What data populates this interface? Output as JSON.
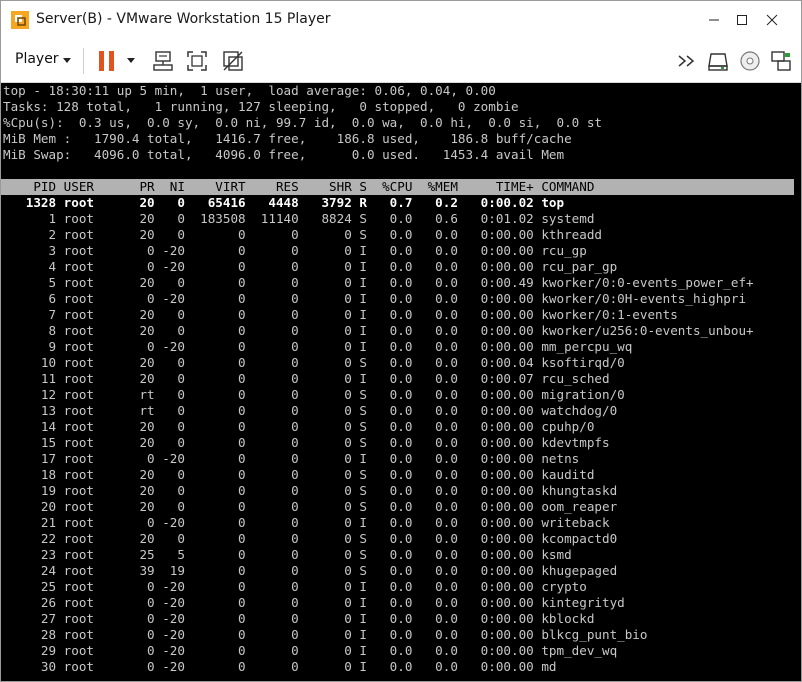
{
  "window": {
    "title": "Server(B) - VMware Workstation 15 Player"
  },
  "toolbar": {
    "player_label": "Player",
    "icons": [
      "pause-icon",
      "send-ctrl-alt-del-icon",
      "fullscreen-icon",
      "unity-icon",
      "forward-icon",
      "removable-device-icon",
      "cd-icon",
      "network-icon"
    ]
  },
  "colors": {
    "pause": "#e0541e",
    "header_bg": "#b2b2b2",
    "terminal_bg": "#000000",
    "terminal_fg": "#c8c8c8"
  },
  "top": {
    "summary": [
      "top - 18:30:11 up 5 min,  1 user,  load average: 0.06, 0.04, 0.00",
      "Tasks: 128 total,   1 running, 127 sleeping,   0 stopped,   0 zombie",
      "%Cpu(s):  0.3 us,  0.0 sy,  0.0 ni, 99.7 id,  0.0 wa,  0.0 hi,  0.0 si,  0.0 st",
      "MiB Mem :   1790.4 total,   1416.7 free,    186.8 used,    186.8 buff/cache",
      "MiB Swap:   4096.0 total,   4096.0 free,      0.0 used.   1453.4 avail Mem"
    ],
    "columns": [
      "PID",
      "USER",
      "PR",
      "NI",
      "VIRT",
      "RES",
      "SHR",
      "S",
      "%CPU",
      "%MEM",
      "TIME+",
      "COMMAND"
    ],
    "processes": [
      [
        "1328",
        "root",
        "20",
        "0",
        "65416",
        "4448",
        "3792",
        "R",
        "0.7",
        "0.2",
        "0:00.02",
        "top"
      ],
      [
        "1",
        "root",
        "20",
        "0",
        "183508",
        "11140",
        "8824",
        "S",
        "0.0",
        "0.6",
        "0:01.02",
        "systemd"
      ],
      [
        "2",
        "root",
        "20",
        "0",
        "0",
        "0",
        "0",
        "S",
        "0.0",
        "0.0",
        "0:00.00",
        "kthreadd"
      ],
      [
        "3",
        "root",
        "0",
        "-20",
        "0",
        "0",
        "0",
        "I",
        "0.0",
        "0.0",
        "0:00.00",
        "rcu_gp"
      ],
      [
        "4",
        "root",
        "0",
        "-20",
        "0",
        "0",
        "0",
        "I",
        "0.0",
        "0.0",
        "0:00.00",
        "rcu_par_gp"
      ],
      [
        "5",
        "root",
        "20",
        "0",
        "0",
        "0",
        "0",
        "I",
        "0.0",
        "0.0",
        "0:00.49",
        "kworker/0:0-events_power_ef+"
      ],
      [
        "6",
        "root",
        "0",
        "-20",
        "0",
        "0",
        "0",
        "I",
        "0.0",
        "0.0",
        "0:00.00",
        "kworker/0:0H-events_highpri"
      ],
      [
        "7",
        "root",
        "20",
        "0",
        "0",
        "0",
        "0",
        "I",
        "0.0",
        "0.0",
        "0:00.00",
        "kworker/0:1-events"
      ],
      [
        "8",
        "root",
        "20",
        "0",
        "0",
        "0",
        "0",
        "I",
        "0.0",
        "0.0",
        "0:00.00",
        "kworker/u256:0-events_unbou+"
      ],
      [
        "9",
        "root",
        "0",
        "-20",
        "0",
        "0",
        "0",
        "I",
        "0.0",
        "0.0",
        "0:00.00",
        "mm_percpu_wq"
      ],
      [
        "10",
        "root",
        "20",
        "0",
        "0",
        "0",
        "0",
        "S",
        "0.0",
        "0.0",
        "0:00.04",
        "ksoftirqd/0"
      ],
      [
        "11",
        "root",
        "20",
        "0",
        "0",
        "0",
        "0",
        "I",
        "0.0",
        "0.0",
        "0:00.07",
        "rcu_sched"
      ],
      [
        "12",
        "root",
        "rt",
        "0",
        "0",
        "0",
        "0",
        "S",
        "0.0",
        "0.0",
        "0:00.00",
        "migration/0"
      ],
      [
        "13",
        "root",
        "rt",
        "0",
        "0",
        "0",
        "0",
        "S",
        "0.0",
        "0.0",
        "0:00.00",
        "watchdog/0"
      ],
      [
        "14",
        "root",
        "20",
        "0",
        "0",
        "0",
        "0",
        "S",
        "0.0",
        "0.0",
        "0:00.00",
        "cpuhp/0"
      ],
      [
        "15",
        "root",
        "20",
        "0",
        "0",
        "0",
        "0",
        "S",
        "0.0",
        "0.0",
        "0:00.00",
        "kdevtmpfs"
      ],
      [
        "17",
        "root",
        "0",
        "-20",
        "0",
        "0",
        "0",
        "I",
        "0.0",
        "0.0",
        "0:00.00",
        "netns"
      ],
      [
        "18",
        "root",
        "20",
        "0",
        "0",
        "0",
        "0",
        "S",
        "0.0",
        "0.0",
        "0:00.00",
        "kauditd"
      ],
      [
        "19",
        "root",
        "20",
        "0",
        "0",
        "0",
        "0",
        "S",
        "0.0",
        "0.0",
        "0:00.00",
        "khungtaskd"
      ],
      [
        "20",
        "root",
        "20",
        "0",
        "0",
        "0",
        "0",
        "S",
        "0.0",
        "0.0",
        "0:00.00",
        "oom_reaper"
      ],
      [
        "21",
        "root",
        "0",
        "-20",
        "0",
        "0",
        "0",
        "I",
        "0.0",
        "0.0",
        "0:00.00",
        "writeback"
      ],
      [
        "22",
        "root",
        "20",
        "0",
        "0",
        "0",
        "0",
        "S",
        "0.0",
        "0.0",
        "0:00.00",
        "kcompactd0"
      ],
      [
        "23",
        "root",
        "25",
        "5",
        "0",
        "0",
        "0",
        "S",
        "0.0",
        "0.0",
        "0:00.00",
        "ksmd"
      ],
      [
        "24",
        "root",
        "39",
        "19",
        "0",
        "0",
        "0",
        "S",
        "0.0",
        "0.0",
        "0:00.00",
        "khugepaged"
      ],
      [
        "25",
        "root",
        "0",
        "-20",
        "0",
        "0",
        "0",
        "I",
        "0.0",
        "0.0",
        "0:00.00",
        "crypto"
      ],
      [
        "26",
        "root",
        "0",
        "-20",
        "0",
        "0",
        "0",
        "I",
        "0.0",
        "0.0",
        "0:00.00",
        "kintegrityd"
      ],
      [
        "27",
        "root",
        "0",
        "-20",
        "0",
        "0",
        "0",
        "I",
        "0.0",
        "0.0",
        "0:00.00",
        "kblockd"
      ],
      [
        "28",
        "root",
        "0",
        "-20",
        "0",
        "0",
        "0",
        "I",
        "0.0",
        "0.0",
        "0:00.00",
        "blkcg_punt_bio"
      ],
      [
        "29",
        "root",
        "0",
        "-20",
        "0",
        "0",
        "0",
        "I",
        "0.0",
        "0.0",
        "0:00.00",
        "tpm_dev_wq"
      ],
      [
        "30",
        "root",
        "0",
        "-20",
        "0",
        "0",
        "0",
        "I",
        "0.0",
        "0.0",
        "0:00.00",
        "md"
      ]
    ]
  }
}
